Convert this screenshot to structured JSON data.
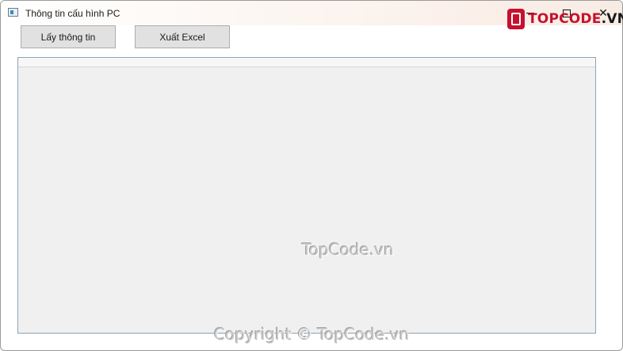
{
  "window": {
    "title": "Thông tin cấu hình PC",
    "minimize_symbol": "",
    "maximize_symbol": "",
    "close_symbol": "✕"
  },
  "logo": {
    "brand": "TOPCODE",
    "domain": ".VN",
    "brand_color": "#c8102e"
  },
  "toolbar": {
    "get_info_label": "Lấy thông tin",
    "export_excel_label": "Xuất Excel"
  },
  "watermarks": {
    "center": "TopCode.vn",
    "bottom": "Copyright © TopCode.vn"
  },
  "icons": {
    "app": "window-app-icon",
    "minimize": "minimize-icon",
    "maximize": "maximize-icon",
    "close": "close-icon"
  }
}
